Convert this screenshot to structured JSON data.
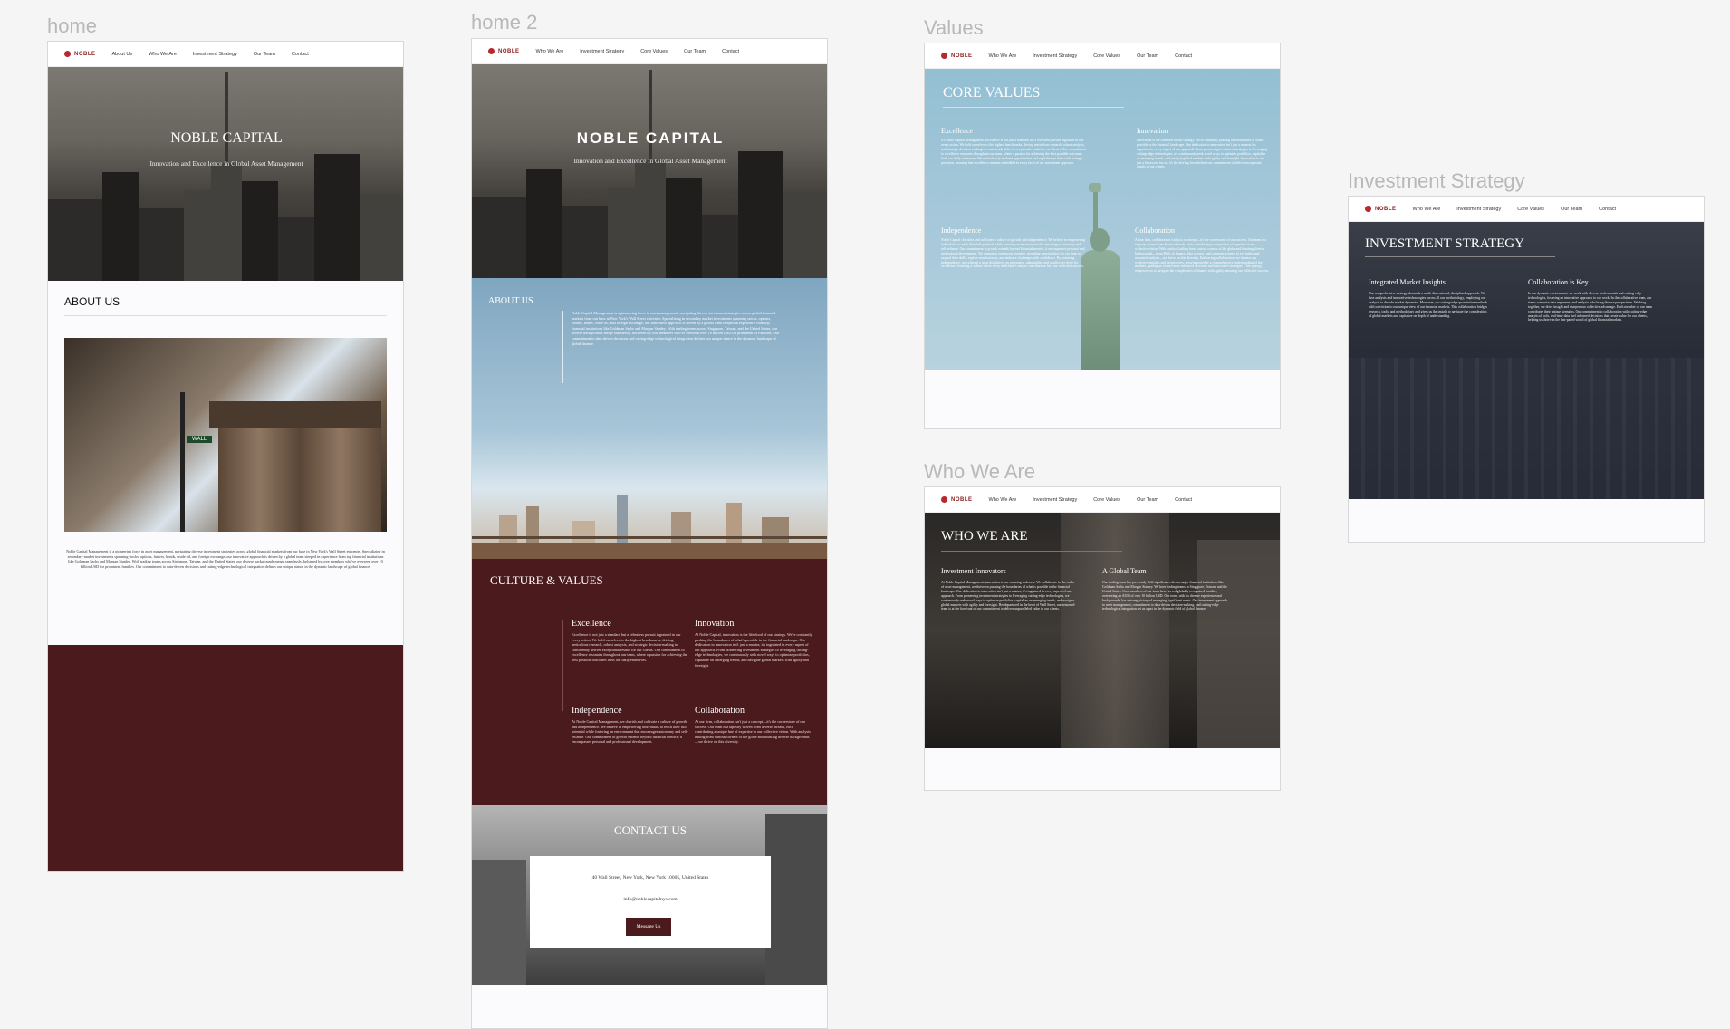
{
  "frames": {
    "home": {
      "label": "home",
      "nav": [
        "About Us",
        "Who We Are",
        "Investment Strategy",
        "Our Team",
        "Contact"
      ],
      "logo": "NOBLE",
      "hero_title": "NOBLE CAPITAL",
      "hero_sub": "Innovation and Excellence in Global Asset Management",
      "about_title": "ABOUT US",
      "about_text": "Noble Capital Management is a pioneering force in asset management, navigating diverse investment strategies across global financial markets from our base in New York's Wall Street epicenter. Specializing in secondary market investments spanning stocks, options, futures, bonds, crude oil, and foreign exchange, our innovative approach is driven by a global team steeped in experience from top financial institutions like Goldman Sachs and Morgan Stanley. With trading teams across Singapore, Taiwan, and the United States, our diverse backgrounds merge seamlessly, bolstered by core members who've overseen over 10 billion USD for prominent families. Our commitment to data-driven decisions and cutting-edge technological integration defines our unique stance in the dynamic landscape of global finance.",
      "wall_sign": "WALL"
    },
    "home2": {
      "label": "home 2",
      "nav": [
        "Who We Are",
        "Investment Strategy",
        "Core Values",
        "Our Team",
        "Contact"
      ],
      "logo": "NOBLE",
      "hero_title": "NOBLE CAPITAL",
      "hero_sub": "Innovation and Excellence in Global Asset Management",
      "about_title": "ABOUT US",
      "about_text": "Noble Capital Management is a pioneering force in asset management, navigating diverse investment strategies across global financial markets from our base in New York's Wall Street epicenter. Specializing in secondary market investments spanning stocks, options, futures, bonds, crude oil, and foreign exchange, our innovative approach is driven by a global team steeped in experience from top financial institutions like Goldman Sachs and Morgan Stanley. With trading teams across Singapore, Taiwan, and the United States, our diverse backgrounds merge seamlessly, bolstered by core members who've overseen over 10 billion USD for prominent of Families. Our commitment to data-driven decisions and cutting-edge technological integration defines our unique stance in the dynamic landscape of global finance.",
      "culture_title": "CULTURE & VALUES",
      "values": [
        {
          "title": "Excellence",
          "text": "Excellence is not just a standard but a relentless pursuit ingrained in our every action. We hold ourselves to the highest benchmarks, driving meticulous research, robust analysis, and strategic decision-making to consistently deliver exceptional results for our clients. Our commitment to excellence resonates throughout our team, where a passion for achieving the best possible outcomes fuels our daily endeavors."
        },
        {
          "title": "Innovation",
          "text": "At Noble Capital, innovation is the lifeblood of our strategy. We're constantly pushing the boundaries of what's possible in the financial landscape. Our dedication to innovation isn't just a mantra; it's ingrained in every aspect of our approach. From pioneering investment strategies to leveraging cutting-edge technologies, we continuously seek novel ways to optimize portfolios, capitalize on emerging trends, and navigate global markets with agility and foresight."
        },
        {
          "title": "Independence",
          "text": "At Noble Capital Management, we cherish and cultivate a culture of growth and independence. We believe in empowering individuals to reach their full potential while fostering an environment that encourages autonomy and self-reliance. Our commitment to growth extends beyond financial metrics; it encompasses personal and professional development."
        },
        {
          "title": "Collaboration",
          "text": "At our firm, collaboration isn't just a concept—it's the cornerstone of our success. Our team is a tapestry woven from diverse threads, each contributing a unique hue of expertise to our collective vision. With analysts hailing from various corners of the globe and boasting diverse backgrounds—we thrive on this diversity."
        }
      ],
      "contact_title": "CONTACT US",
      "contact_address": "40 Wall Street, New York, New York 10005, United States",
      "contact_email": "info@noblecapitalnys.com",
      "contact_button": "Message Us"
    },
    "values": {
      "label": "Values",
      "nav": [
        "Who We Are",
        "Investment Strategy",
        "Core Values",
        "Our Team",
        "Contact"
      ],
      "logo": "NOBLE",
      "title": "CORE VALUES",
      "items": [
        {
          "title": "Excellence",
          "text": "At Noble Capital Management, excellence is not just a standard but a relentless pursuit ingrained in our every action. We hold ourselves to the highest benchmarks, driving meticulous research, robust analysis, and strategic decision-making to consistently deliver exceptional results for our clients. Our commitment to excellence resonates throughout our team, where a passion for achieving the best possible outcomes fuels our daily endeavors. We meticulously evaluate opportunities and capitalize on them with strategic precision, ensuring that excellence remains embedded in every facet of our investment approach."
        },
        {
          "title": "Innovation",
          "text": "Innovation is the lifeblood of our strategy. We're constantly pushing the boundaries of what's possible in the financial landscape. Our dedication to innovation isn't just a mantra; it's ingrained in every aspect of our approach. From pioneering investment strategies to leveraging cutting-edge technologies, we continuously seek novel ways to optimize portfolios, capitalize on emerging trends, and navigate global markets with agility and foresight. Innovation is not just a buzzword for us; it's the driving force behind our commitment to deliver exceptional results to our clients."
        },
        {
          "title": "Independence",
          "text": "Noble Capital cherishes and cultivates a culture of growth and independence. We believe in empowering individuals to reach their full potential while fostering an environment that encourages autonomy and self-reliance. Our commitment to growth extends beyond financial metrics; it encompasses personal and professional development. We champion continuous learning, providing opportunities for our team to expand their skills, explore new horizons, and embrace challenges with confidence. By nurturing independence, we cultivate a team that thrives on innovation, adaptability, and a collective drive for excellence, fostering a culture where every individual's unique contributions fuel our collective success."
        },
        {
          "title": "Collaboration",
          "text": "At our firm, collaboration isn't just a concept—it's the cornerstone of our success. Our team is a tapestry woven from diverse threads, each contributing a unique hue of expertise to our collective vision. With analysts hailing from various corners of the globe and boasting diverse backgrounds—from PhDs in finance, data science, and computer science to ex-traders and seasoned analysts—we thrive on this diversity. Embracing collaboration, we harness our collective insights and perspectives, weaving together a comprehensive understanding of the markets, guiding us toward more informed decisions and innovative strategies. This synergy empowers us to navigate the complexities of finance with agility, ensuring our collective success."
        }
      ]
    },
    "who": {
      "label": "Who We Are",
      "nav": [
        "Who We Are",
        "Investment Strategy",
        "Core Values",
        "Our Team",
        "Contact"
      ],
      "logo": "NOBLE",
      "title": "WHO WE ARE",
      "col1_title": "Investment Innovators",
      "col1_text": "At Noble Capital Management, innovation is our enduring endeavor. We collaborate in the realm of asset management, we thrive on pushing the boundaries of what is possible in the financial landscape. Our dedication to innovation isn't just a mantra; it's ingrained in every aspect of our approach. From pioneering investment strategies to leveraging cutting-edge technologies, we continuously seek novel ways to optimize portfolios, capitalize on emerging trends, and navigate global markets with agility and foresight. Headquartered in the heart of Wall Street, our seasoned team is at the forefront of our commitment to deliver unparalleled value to our clients.",
      "col2_title": "A Global Team",
      "col2_text": "Our trading team has previously held significant roles in major financial institutions like Goldman Sachs and Morgan Stanley. We have trading teams in Singapore, Taiwan, and the United States. Core members of our team have served globally recognized families, overseeing an AUM of over 10 billion USD. Our team, with its diverse experience and backgrounds, has a strong history of managing significant assets. Our investment approach to asset management, commitment to data-driven decision-making, and cutting-edge technological integration set us apart in the dynamic field of global finance."
    },
    "invest": {
      "label": "Investment Strategy",
      "nav": [
        "Who We Are",
        "Investment Strategy",
        "Core Values",
        "Our Team",
        "Contact"
      ],
      "logo": "NOBLE",
      "title": "INVESTMENT STRATEGY",
      "col1_title": "Integrated Market Insights",
      "col1_text": "Our comprehensive strategy demands a multi-dimensional, disciplined approach. We fuse analysis and innovative technologies across all our methodology, employing our analysts to decode market dynamics. Moreover, our cutting-edge quantitative methods add conviction to our unique view of our financial markets. This collaboration bridges research, tools, and methodology and gives us the insight to navigate the complexities of global markets and capitalize on depth of understanding.",
      "col2_title": "Collaboration is Key",
      "col2_text": "In our dynamic environment, we work with diverse professionals and cutting-edge technologies, fostering an innovative approach to our work. In the collaborative team, our teams comprise data engineers, and analysts who bring diverse perspectives. Working together, we drive insight and sharpen our collective advantage. Each member of our team contributes their unique strengths. Our commitment to collaboration with cutting-edge analytical tools, real-time data fuel informed decisions that create value for our clients, helping us thrive in the fast-paced world of global financial markets."
    }
  },
  "colors": {
    "maroon": "#4b1a1c",
    "brand_red": "#b8282e",
    "sky_blue": "#93bfd2"
  },
  "icons": [
    "logo-circle-icon"
  ]
}
